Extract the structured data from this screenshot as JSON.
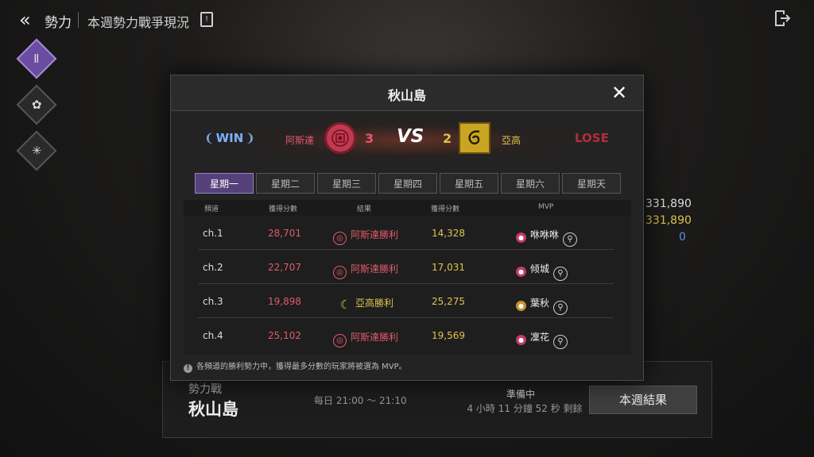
{
  "topbar": {
    "back_icon": "«",
    "title": "勢力",
    "subtitle": "本週勢力戰爭現況",
    "doc_icon": "!"
  },
  "sidenav": {
    "items": [
      {
        "icon": "Ⅱ",
        "active": true
      },
      {
        "icon": "✿",
        "active": false
      },
      {
        "icon": "✳",
        "active": false
      }
    ]
  },
  "background": {
    "num1": "331,890",
    "num2": "331,890",
    "num3": "0"
  },
  "bottom": {
    "label_small": "勢力戰",
    "label_big": "秋山島",
    "time": "每日 21:00 ～ 21:10",
    "status": "準備中",
    "remaining": "4 小時 11 分鐘 52 秒 剩餘",
    "week_result_button": "本週結果"
  },
  "modal": {
    "title": "秋山島",
    "close_icon": "✕",
    "win_label": "WIN",
    "lose_label": "LOSE",
    "vs_label": "VS",
    "factions": {
      "a": {
        "name": "阿斯達",
        "score": "3",
        "color": "#e15a6c"
      },
      "b": {
        "name": "亞高",
        "score": "2",
        "color": "#e0c24e"
      }
    },
    "tabs": [
      "星期一",
      "星期二",
      "星期三",
      "星期四",
      "星期五",
      "星期六",
      "星期天"
    ],
    "active_tab": 0,
    "columns": {
      "channel": "頻道",
      "score_a": "獲得分數",
      "result": "結果",
      "score_b": "獲得分數",
      "mvp": "MVP"
    },
    "rows": [
      {
        "channel": "ch.1",
        "score_a": "28,701",
        "result": "阿斯達勝利",
        "winner": "a",
        "score_b": "14,328",
        "mvp": "咻咻咻"
      },
      {
        "channel": "ch.2",
        "score_a": "22,707",
        "result": "阿斯達勝利",
        "winner": "a",
        "score_b": "17,031",
        "mvp": "倾城"
      },
      {
        "channel": "ch.3",
        "score_a": "19,898",
        "result": "亞高勝利",
        "winner": "b",
        "score_b": "25,275",
        "mvp": "葉秋"
      },
      {
        "channel": "ch.4",
        "score_a": "25,102",
        "result": "阿斯達勝利",
        "winner": "a",
        "score_b": "19,569",
        "mvp": "凜花"
      }
    ],
    "note": "各頻道的勝利勢力中，獲得最多分數的玩家將被選為 MVP。"
  }
}
